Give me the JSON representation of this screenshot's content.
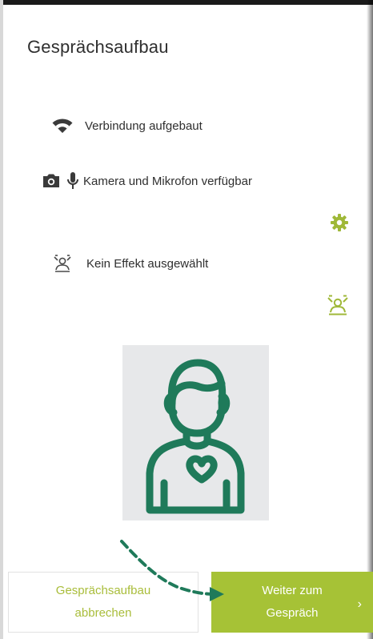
{
  "header": {
    "title": "Gesprächsaufbau"
  },
  "status": {
    "connection": {
      "icon": "wifi-icon",
      "label": "Verbindung aufgebaut"
    },
    "devices": {
      "icons": [
        "camera-icon",
        "microphone-icon"
      ],
      "label": "Kamera und Mikrofon verfügbar"
    },
    "effect": {
      "icon": "background-effect-icon",
      "label": "Kein Effekt ausgewählt"
    }
  },
  "controls": {
    "settings_icon": "gear-icon",
    "effect_icon": "background-effect-icon"
  },
  "preview": {
    "placeholder_icon": "user-avatar-icon"
  },
  "footer": {
    "cancel_line1": "Gesprächsaufbau",
    "cancel_line2": "abbrechen",
    "next_line1": "Weiter zum",
    "next_line2": "Gespräch",
    "next_chevron": "›"
  },
  "colors": {
    "accent": "#a6c236",
    "accent_text": "#a9bd3a",
    "avatar_green": "#1f7a5a",
    "text": "#2f2f2f",
    "icon_dark": "#3a3a3a"
  }
}
